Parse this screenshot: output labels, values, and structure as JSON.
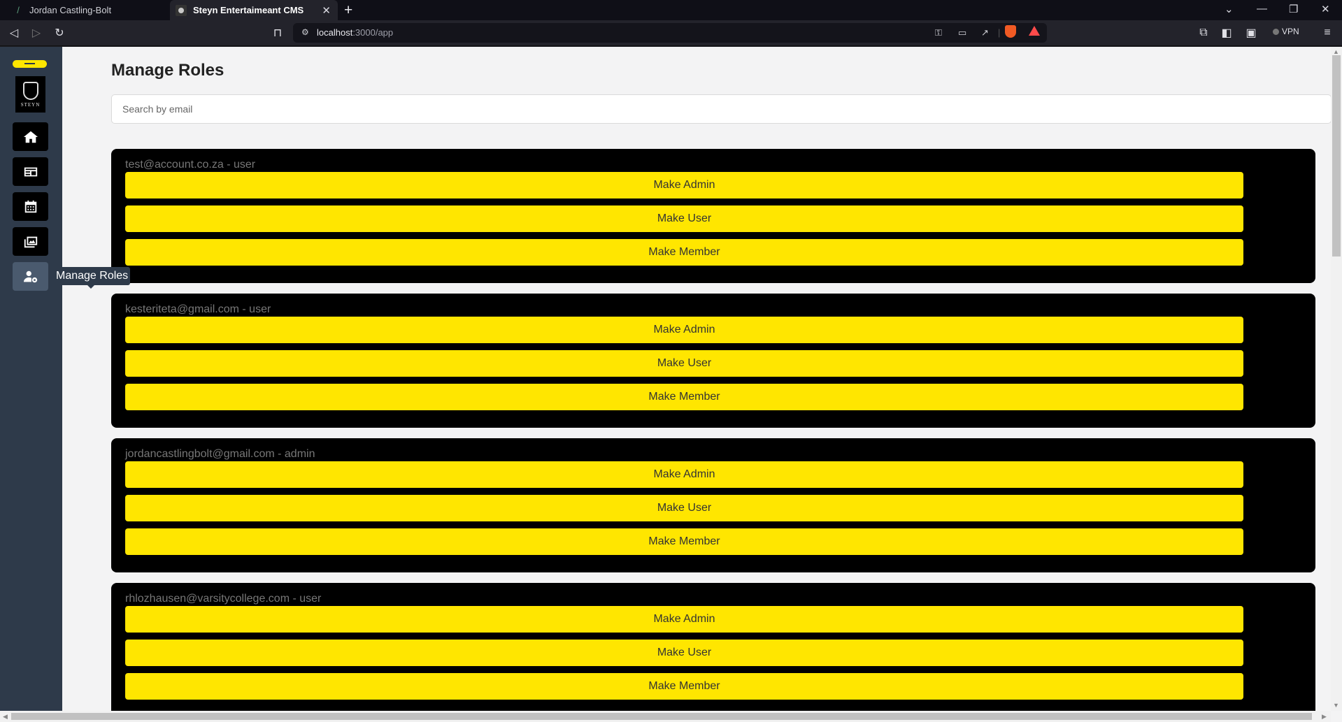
{
  "browser": {
    "tabs": [
      {
        "title": "Jordan Castling-Bolt",
        "active": false
      },
      {
        "title": "Steyn Entertaimeant CMS",
        "active": true
      }
    ],
    "url_host": "localhost",
    "url_path": ":3000/app",
    "vpn_label": "VPN"
  },
  "sidebar": {
    "logo_text": "STEYN",
    "items": [
      {
        "name": "home",
        "icon": "home-icon"
      },
      {
        "name": "news",
        "icon": "newspaper-icon"
      },
      {
        "name": "events",
        "icon": "calendar-icon"
      },
      {
        "name": "gallery",
        "icon": "images-icon"
      },
      {
        "name": "manage-roles",
        "icon": "user-gear-icon",
        "active": true
      }
    ],
    "tooltip": "Manage Roles"
  },
  "main": {
    "title": "Manage Roles",
    "search_placeholder": "Search by email",
    "buttons": {
      "make_admin": "Make Admin",
      "make_user": "Make User",
      "make_member": "Make Member"
    },
    "users": [
      {
        "label": "test@account.co.za - user"
      },
      {
        "label": "kesteriteta@gmail.com - user"
      },
      {
        "label": "jordancastlingbolt@gmail.com - admin"
      },
      {
        "label": "rhlozhausen@varsitycollege.com - user"
      }
    ]
  },
  "colors": {
    "accent_yellow": "#ffe600",
    "sidebar_bg": "#2e3a4a",
    "card_bg": "#000000"
  }
}
